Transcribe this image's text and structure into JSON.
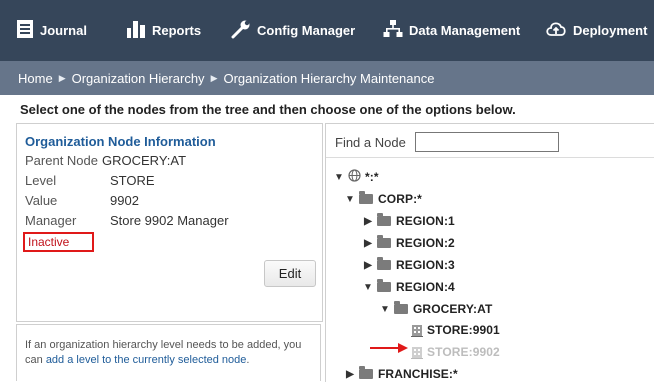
{
  "nav": {
    "items": [
      {
        "label": "Journal",
        "icon": "journal-icon"
      },
      {
        "label": "Reports",
        "icon": "reports-bar-chart-icon"
      },
      {
        "label": "Config Manager",
        "icon": "wrench-icon"
      },
      {
        "label": "Data Management",
        "icon": "hierarchy-icon"
      },
      {
        "label": "Deployment",
        "icon": "upload-cloud-icon"
      }
    ]
  },
  "breadcrumb": {
    "items": [
      "Home",
      "Organization Hierarchy",
      "Organization Hierarchy Maintenance"
    ]
  },
  "instruction": "Select one of the nodes from the tree and then choose one of the options below.",
  "node_info": {
    "title": "Organization Node Information",
    "parent_node_label": "Parent Node",
    "parent_node_value": "GROCERY:AT",
    "level_label": "Level",
    "level_value": "STORE",
    "value_label": "Value",
    "value_value": "9902",
    "manager_label": "Manager",
    "manager_value": "Store 9902 Manager",
    "status": "Inactive",
    "edit_label": "Edit"
  },
  "help": {
    "text": "If an organization hierarchy level needs to be added, you can",
    "link_text": "add a level to the currently selected node",
    "suffix": "."
  },
  "tree": {
    "find_label": "Find a Node",
    "find_value": "",
    "nodes": [
      {
        "label": "*:*",
        "expanded": true
      },
      {
        "label": "CORP:*",
        "expanded": true
      },
      {
        "label": "REGION:1",
        "expanded": false
      },
      {
        "label": "REGION:2",
        "expanded": false
      },
      {
        "label": "REGION:3",
        "expanded": false
      },
      {
        "label": "REGION:4",
        "expanded": true
      },
      {
        "label": "GROCERY:AT",
        "expanded": true
      },
      {
        "label": "STORE:9901"
      },
      {
        "label": "STORE:9902",
        "inactive": true
      },
      {
        "label": "FRANCHISE:*",
        "expanded": false
      }
    ]
  },
  "colors": {
    "nav_bg": "#36465a",
    "breadcrumb_bg": "#66758a",
    "title_blue": "#1f5c99",
    "inactive_red": "#c0111a",
    "highlight_box": "#e01919",
    "arrow_red": "#e01919"
  }
}
